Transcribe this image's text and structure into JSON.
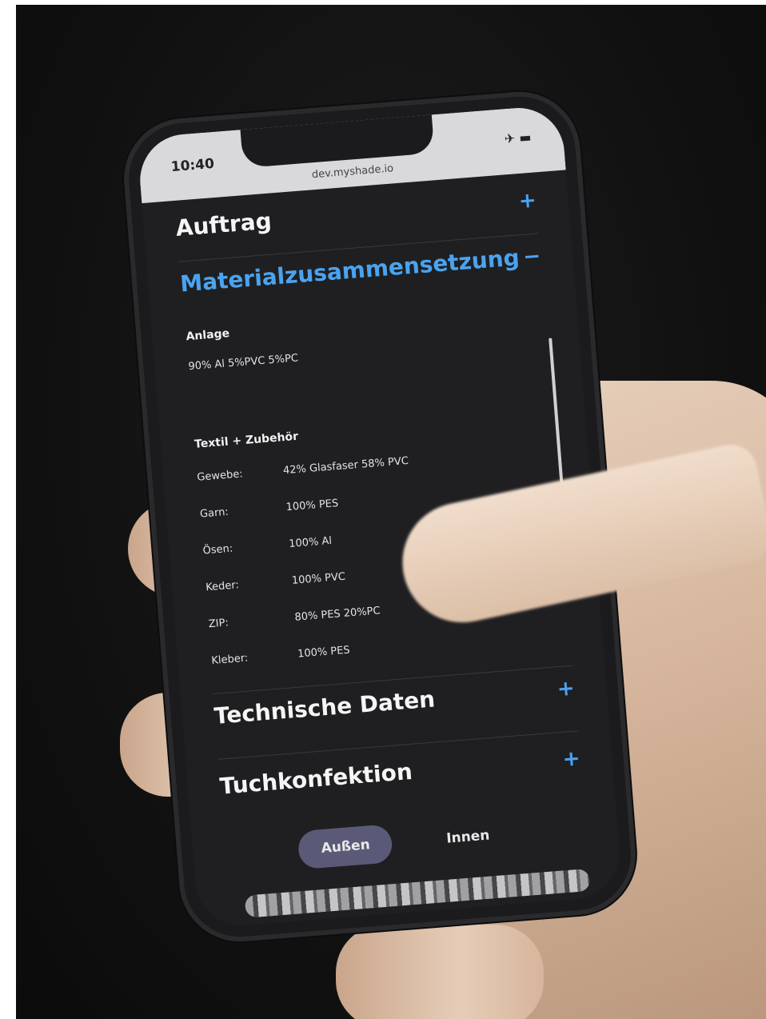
{
  "browser": {
    "time": "10:40",
    "url": "dev.myshade.io"
  },
  "sections": {
    "auftrag": {
      "title": "Auftrag",
      "toggle": "+"
    },
    "material": {
      "title": "Materialzusammensetzung",
      "toggle": "−"
    },
    "technische": {
      "title": "Technische Daten",
      "toggle": "+"
    },
    "tuch": {
      "title": "Tuchkonfektion",
      "toggle": "+"
    }
  },
  "anlage": {
    "heading": "Anlage",
    "value": "90% Al 5%PVC 5%PC"
  },
  "textil": {
    "heading": "Textil + Zubehör",
    "rows": [
      {
        "label": "Gewebe:",
        "value": "42% Glasfaser 58% PVC"
      },
      {
        "label": "Garn:",
        "value": "100% PES"
      },
      {
        "label": "Ösen:",
        "value": "100% Al"
      },
      {
        "label": "Keder:",
        "value": "100% PVC"
      },
      {
        "label": "ZIP:",
        "value": "80% PES 20%PC"
      },
      {
        "label": "Kleber:",
        "value": "100% PES"
      }
    ]
  },
  "segmented": {
    "outside": "Außen",
    "inside": "Innen"
  }
}
